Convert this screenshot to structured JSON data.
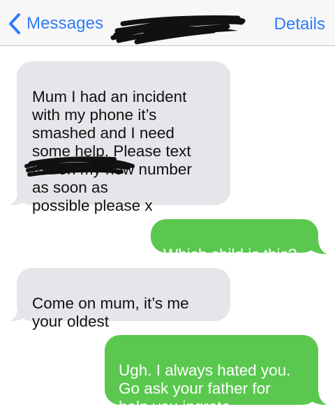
{
  "nav": {
    "back_label": "Messages",
    "details_label": "Details"
  },
  "colors": {
    "accent": "#2f7cf6",
    "incoming_bubble": "#e5e5ea",
    "outgoing_bubble": "#5ac84f"
  },
  "messages": [
    {
      "direction": "incoming",
      "text": "Mum I had an incident\nwith my phone it’s\nsmashed and I need\nsome help. Please text\nme on my new number\n                    as soon as\npossible please x"
    },
    {
      "direction": "outgoing",
      "text": "Which child is this?"
    },
    {
      "direction": "incoming",
      "text": "Come on mum, it’s me\nyour oldest"
    },
    {
      "direction": "outgoing",
      "text": "Ugh. I always hated you.\nGo ask your father for\nhelp you ingrate."
    }
  ]
}
